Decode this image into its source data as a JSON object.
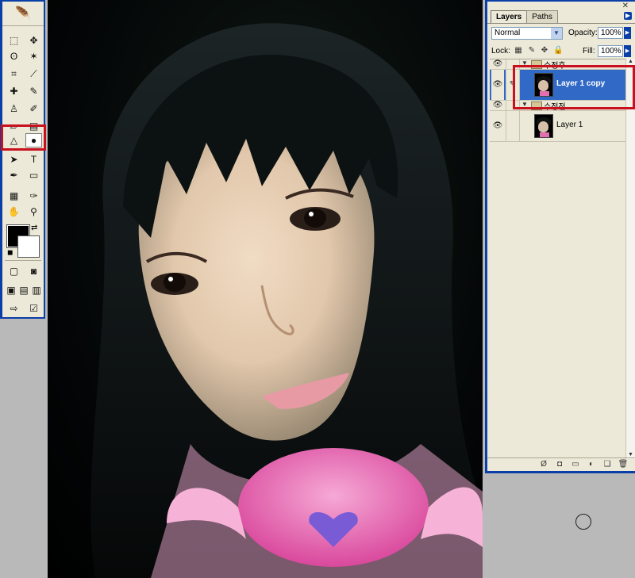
{
  "toolbox": {
    "tools": [
      [
        "marquee-icon",
        "move-icon"
      ],
      [
        "lasso-icon",
        "magic-wand-icon"
      ],
      [
        "crop-icon",
        "slice-icon"
      ],
      [
        "healing-brush-icon",
        "brush-icon"
      ],
      [
        "clone-stamp-icon",
        "history-brush-icon"
      ],
      [
        "eraser-icon",
        "gradient-icon"
      ],
      [
        "blur-icon",
        "dodge-icon"
      ],
      [
        "path-select-icon",
        "type-icon"
      ],
      [
        "pen-icon",
        "shape-icon"
      ],
      [
        "notes-icon",
        "eyedropper-icon"
      ],
      [
        "hand-icon",
        "zoom-icon"
      ]
    ],
    "glyphs": {
      "marquee-icon": "⬚",
      "move-icon": "✥",
      "lasso-icon": "ʘ",
      "magic-wand-icon": "✶",
      "crop-icon": "⌗",
      "slice-icon": "⟋",
      "healing-brush-icon": "✚",
      "brush-icon": "✎",
      "clone-stamp-icon": "♙",
      "history-brush-icon": "✐",
      "eraser-icon": "▱",
      "gradient-icon": "▤",
      "blur-icon": "△",
      "dodge-icon": "●",
      "path-select-icon": "➤",
      "type-icon": "T",
      "pen-icon": "✒",
      "shape-icon": "▭",
      "notes-icon": "▦",
      "eyedropper-icon": "✑",
      "hand-icon": "✋",
      "zoom-icon": "⚲"
    },
    "foreground_color": "#000000",
    "background_color": "#ffffff"
  },
  "layers_panel": {
    "tabs": [
      "Layers",
      "Paths"
    ],
    "blend_mode": "Normal",
    "opacity_label": "Opacity:",
    "opacity_value": "100%",
    "lock_label": "Lock:",
    "fill_label": "Fill:",
    "fill_value": "100%",
    "layers": [
      {
        "name": "수정후",
        "type": "group",
        "visible": true,
        "selected": false
      },
      {
        "name": "Layer 1 copy",
        "type": "layer",
        "visible": true,
        "selected": true
      },
      {
        "name": "수정전",
        "type": "group",
        "visible": true,
        "selected": false
      },
      {
        "name": "Layer 1",
        "type": "layer",
        "visible": true,
        "selected": false
      }
    ]
  },
  "colors": {
    "highlight_red": "#c8101e",
    "window_blue": "#0a3fa8",
    "selection_blue": "#3169c6"
  }
}
